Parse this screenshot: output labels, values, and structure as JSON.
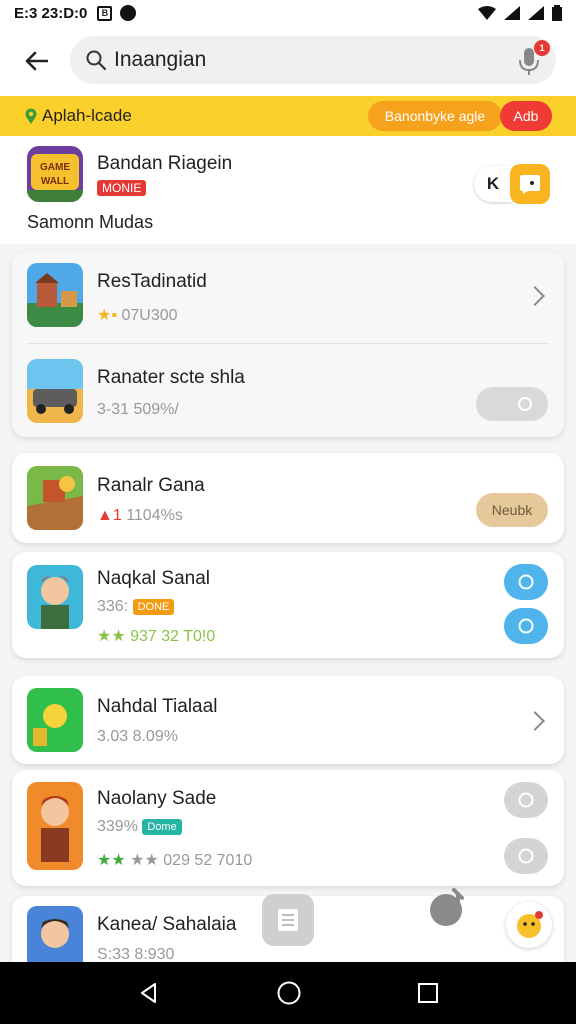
{
  "status_bar": {
    "time": "E:3 23:D:0",
    "notif_glyph": "B"
  },
  "search": {
    "query": "Inaangian",
    "mic_badge": "1"
  },
  "banner": {
    "label": "Aplah-lcade",
    "pill_primary": "Banonbyke agle",
    "pill_secondary": "Adb"
  },
  "featured": {
    "name": "Bandan Riagein",
    "tag": "MONIE",
    "subtitle": "Samonn Mudas",
    "k_button": "K"
  },
  "apps": [
    {
      "title": "ResTadinatid",
      "meta": "07U300",
      "stars": "★▪"
    },
    {
      "title": "Ranater scte shla",
      "meta": "3-31 509%/"
    },
    {
      "title": "Ranalr Gana",
      "meta": "1104%s",
      "rank": "▲1",
      "button": "Neubk"
    },
    {
      "title": "Naqkal Sanal",
      "meta": "336:",
      "tag": "DONE",
      "rating": "★★ 937 32 T0!0"
    },
    {
      "title": "Nahdal Tialaal",
      "meta": "3.03 8.09%"
    },
    {
      "title": "Naolany Sade",
      "meta": "339%",
      "tag": "Dome",
      "rating": "★★ 029 52 7010"
    },
    {
      "title": "Kanea/ Sahalaia",
      "meta": "S:33 8:930"
    }
  ],
  "colors": {
    "accent_yellow": "#fcd02b",
    "accent_orange": "#f7a21c",
    "accent_red": "#ef3b33",
    "accent_blue": "#4fb3ec",
    "accent_green": "#8bc34a"
  }
}
